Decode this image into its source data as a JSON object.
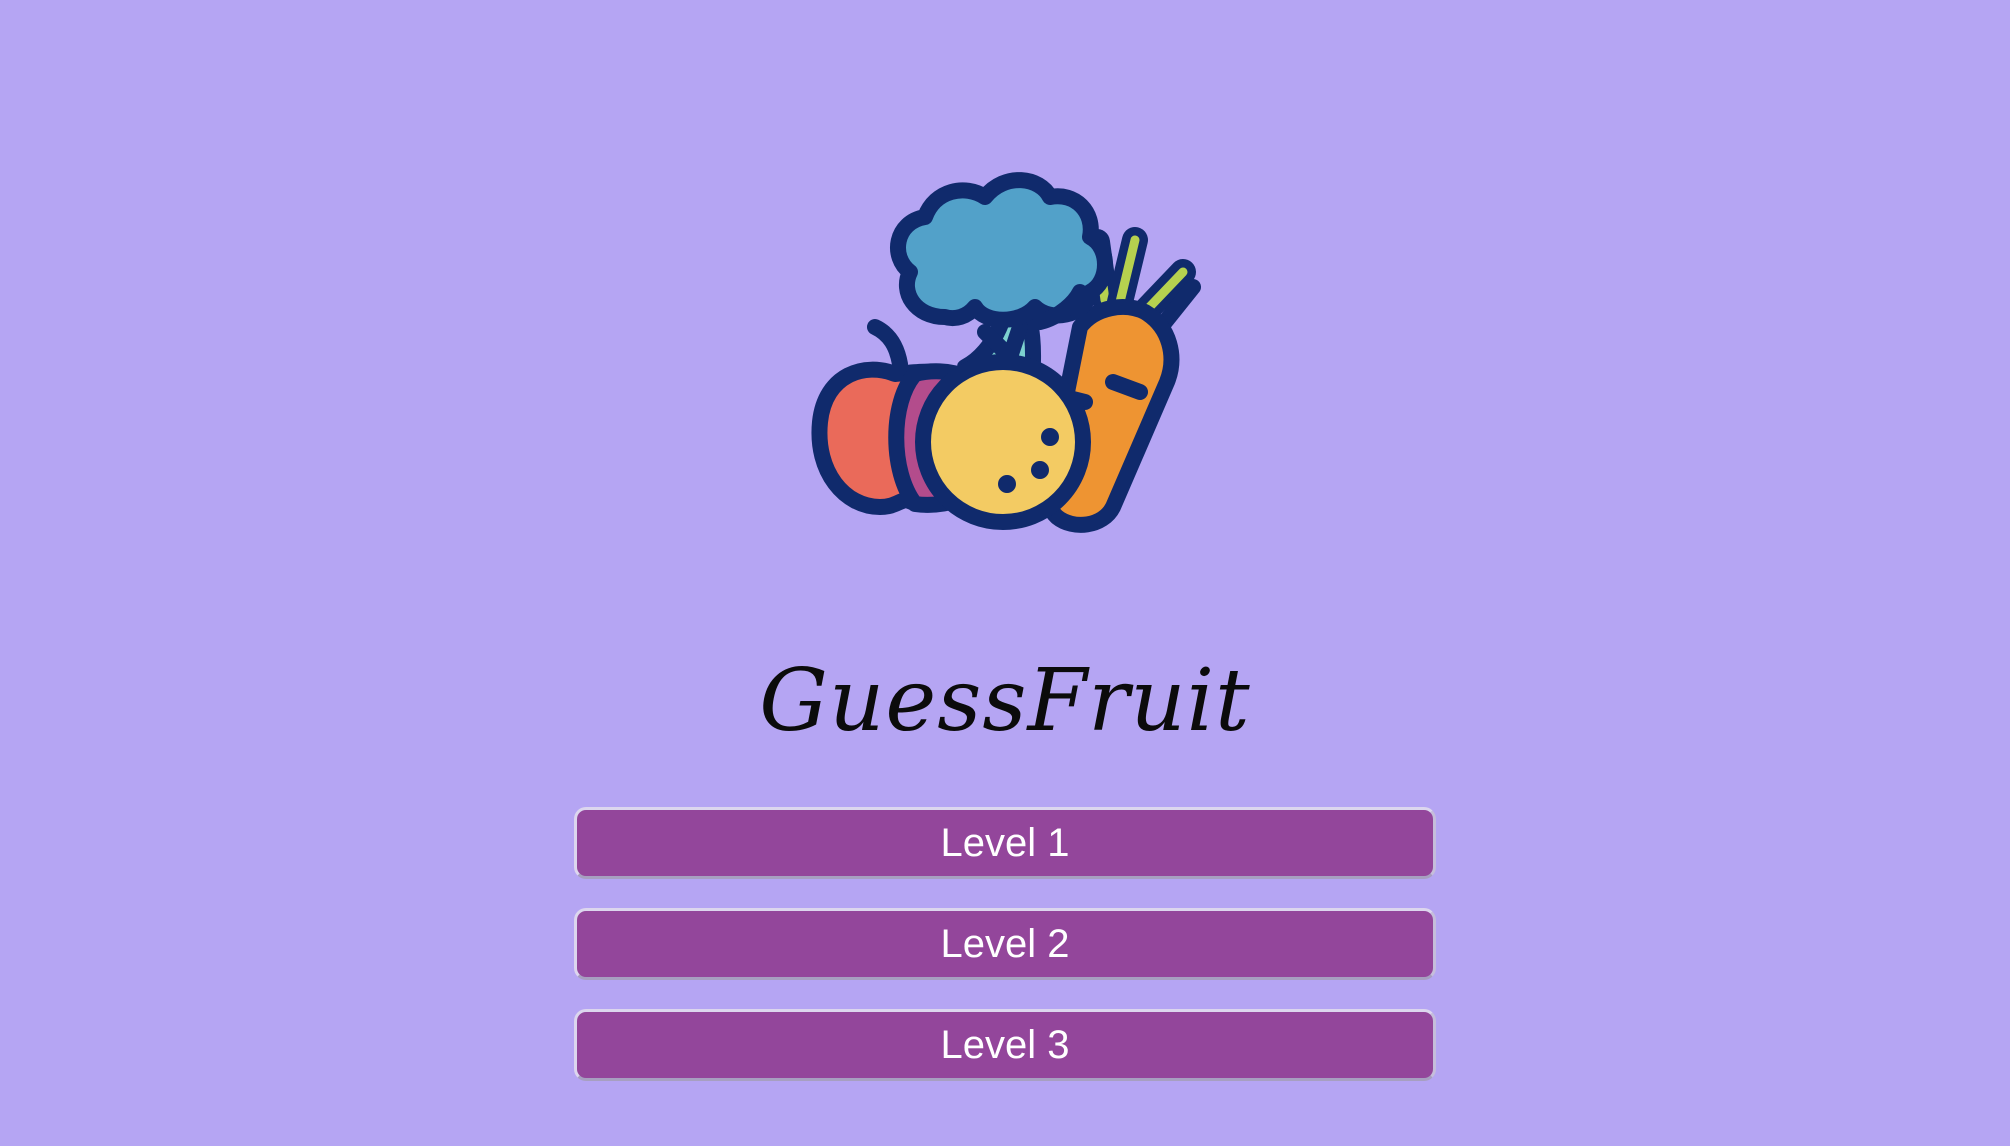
{
  "app": {
    "title": "GuessFruit",
    "logo_icon": "fruits-vegetables-icon"
  },
  "menu": {
    "levels": [
      {
        "label": "Level 1"
      },
      {
        "label": "Level 2"
      },
      {
        "label": "Level 3"
      }
    ]
  },
  "colors": {
    "background": "#b5a5f3",
    "button": "#93469b",
    "button_text": "#ffffff",
    "outline": "#102a6c",
    "broccoli": "#52a1c9",
    "orange": "#f3cb63",
    "apple": "#ea6a5a",
    "carrot": "#ee9432",
    "leaf": "#b6d14f"
  }
}
